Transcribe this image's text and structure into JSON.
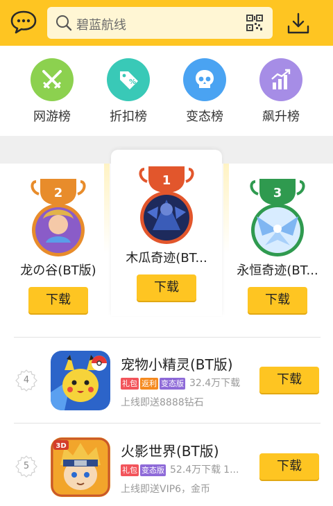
{
  "header": {
    "search_placeholder": "碧蓝航线",
    "chat_icon": "chat-bubble-icon",
    "search_icon": "search-icon",
    "qr_icon": "qr-code-icon",
    "download_icon": "download-icon"
  },
  "categories": [
    {
      "label": "网游榜",
      "icon": "crossed-swords-icon",
      "color": "#8cd14f"
    },
    {
      "label": "折扣榜",
      "icon": "price-tag-icon",
      "color": "#39c9b7"
    },
    {
      "label": "变态榜",
      "icon": "skull-icon",
      "color": "#4aa3f2"
    },
    {
      "label": "飙升榜",
      "icon": "rising-chart-icon",
      "color": "#a68de6"
    }
  ],
  "podium": [
    {
      "rank": "2",
      "name": "龙の谷(BT版)",
      "button": "下载",
      "medal_color": "#e88c2b"
    },
    {
      "rank": "1",
      "name": "木瓜奇迹(BT...",
      "button": "下载",
      "medal_color": "#e2562c"
    },
    {
      "rank": "3",
      "name": "永恒奇迹(BT...",
      "button": "下载",
      "medal_color": "#2f9a4f"
    }
  ],
  "list": [
    {
      "rank": "4",
      "name": "宠物小精灵(BT版)",
      "tags": [
        {
          "text": "礼包",
          "color": "#f2545b"
        },
        {
          "text": "返利",
          "color": "#f58a1f"
        },
        {
          "text": "变态版",
          "color": "#8e6ad8"
        }
      ],
      "downloads": "32.4万下载",
      "desc": "上线即送8888钻石",
      "button": "下载"
    },
    {
      "rank": "5",
      "name": "火影世界(BT版)",
      "tags": [
        {
          "text": "礼包",
          "color": "#f2545b"
        },
        {
          "text": "变态版",
          "color": "#8e6ad8"
        }
      ],
      "downloads": "52.4万下载",
      "downloads_extra": "1...",
      "desc": "上线即送VIP6，金币",
      "button": "下载"
    }
  ],
  "colors": {
    "brand": "#fec522",
    "background_gap": "#efefef"
  }
}
